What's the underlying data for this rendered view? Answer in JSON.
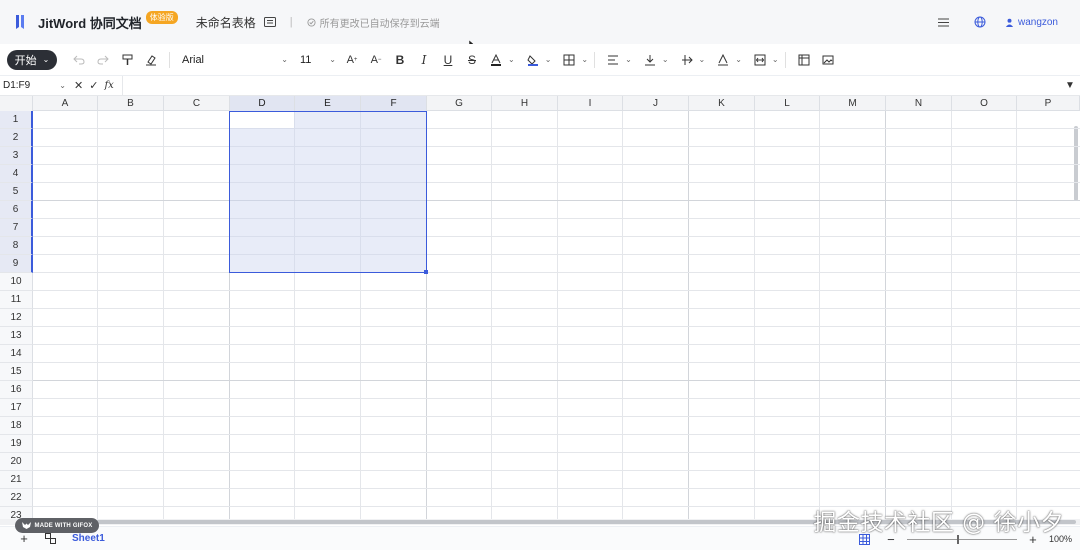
{
  "header": {
    "brand": "JitWord 协同文档",
    "badge": "体验版",
    "doc_title": "未命名表格",
    "separator": "|",
    "save_status": "所有更改已自动保存到云端",
    "user_name": "wangzon"
  },
  "toolbar": {
    "start_label": "开始",
    "font_family": "Arial",
    "font_size": "11"
  },
  "formula_bar": {
    "cell_ref": "D1:F9",
    "fx_label": "fx",
    "value": ""
  },
  "grid": {
    "columns": [
      "A",
      "B",
      "C",
      "D",
      "E",
      "F",
      "G",
      "H",
      "I",
      "J",
      "K",
      "L",
      "M",
      "N",
      "O",
      "P"
    ],
    "rows": [
      "1",
      "2",
      "3",
      "4",
      "5",
      "6",
      "7",
      "8",
      "9",
      "10",
      "11",
      "12",
      "13",
      "14",
      "15",
      "16",
      "17",
      "18",
      "19",
      "20",
      "21",
      "22",
      "23"
    ],
    "selected_range": "D1:F9"
  },
  "bottom": {
    "sheet_tab": "Sheet1",
    "zoom": "100%"
  },
  "overlay": {
    "gifox_badge": "MADE WITH GIFOX",
    "watermark": "掘金技术社区 @ 徐小夕"
  },
  "colors": {
    "accent": "#3b5bdb",
    "selection_fill": "#e1e5f2",
    "badge": "#f5a623",
    "start_button": "#2c2f36"
  }
}
